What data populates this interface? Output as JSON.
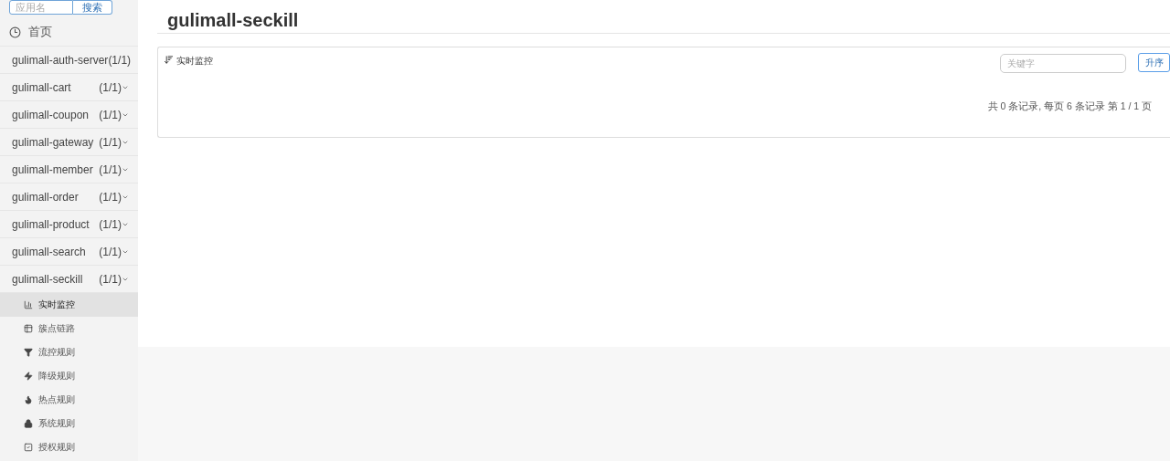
{
  "sidebar": {
    "search": {
      "placeholder": "应用名",
      "button": "搜索"
    },
    "home": {
      "label": "首页"
    },
    "apps": [
      {
        "name": "gulimall-auth-server",
        "count": "(1/1)"
      },
      {
        "name": "gulimall-cart",
        "count": "(1/1)"
      },
      {
        "name": "gulimall-coupon",
        "count": "(1/1)"
      },
      {
        "name": "gulimall-gateway",
        "count": "(1/1)"
      },
      {
        "name": "gulimall-member",
        "count": "(1/1)"
      },
      {
        "name": "gulimall-order",
        "count": "(1/1)"
      },
      {
        "name": "gulimall-product",
        "count": "(1/1)"
      },
      {
        "name": "gulimall-search",
        "count": "(1/1)"
      },
      {
        "name": "gulimall-seckill",
        "count": "(1/1)",
        "children": [
          {
            "kind": "chart",
            "label": "实时监控",
            "selected": true
          },
          {
            "kind": "table",
            "label": "簇点链路",
            "selected": false
          },
          {
            "kind": "filter",
            "label": "流控规则",
            "selected": false
          },
          {
            "kind": "bolt",
            "label": "降级规则",
            "selected": false
          },
          {
            "kind": "fire",
            "label": "热点规则",
            "selected": false
          },
          {
            "kind": "lock",
            "label": "系统规则",
            "selected": false
          },
          {
            "kind": "check",
            "label": "授权规则",
            "selected": false
          }
        ]
      }
    ]
  },
  "main": {
    "title": "gulimall-seckill",
    "panel": {
      "title": "实时监控",
      "search": {
        "placeholder": "关键字"
      },
      "sort_button": "升序",
      "pagination": "共 0 条记录, 每页 6 条记录 第 1 / 1 页"
    }
  }
}
